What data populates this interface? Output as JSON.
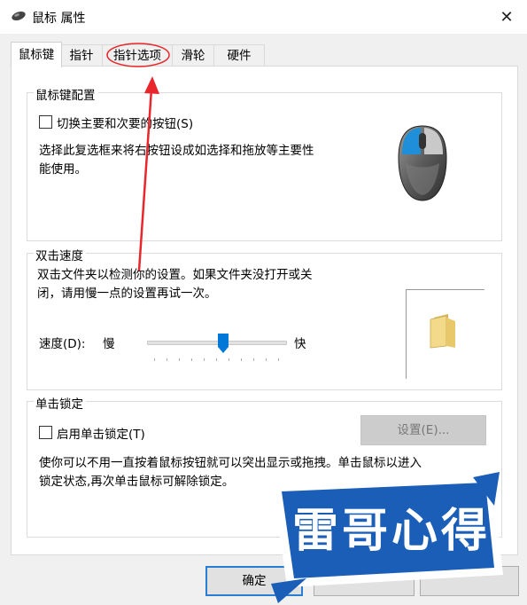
{
  "window": {
    "title": "鼠标 属性",
    "close_glyph": "✕"
  },
  "tabs": [
    {
      "label": "鼠标键",
      "active": true
    },
    {
      "label": "指针",
      "active": false
    },
    {
      "label": "指针选项",
      "active": false
    },
    {
      "label": "滑轮",
      "active": false
    },
    {
      "label": "硬件",
      "active": false
    }
  ],
  "button_config": {
    "title": "鼠标键配置",
    "checkbox_label": "切换主要和次要的按钮(S)",
    "checked": false,
    "description_line1": "选择此复选框来将右按钮设成如选择和拖放等主要性",
    "description_line2": "能使用。"
  },
  "double_click": {
    "title": "双击速度",
    "description_line1": "双击文件夹以检测你的设置。如果文件夹没打开或关",
    "description_line2": "闭，请用慢一点的设置再试一次。",
    "speed_label": "速度(D):",
    "slow_label": "慢",
    "fast_label": "快",
    "speed_value_fraction": 0.55
  },
  "click_lock": {
    "title": "单击锁定",
    "checkbox_label": "启用单击锁定(T)",
    "checked": false,
    "settings_button": "设置(E)...",
    "description_line1": "使你可以不用一直按着鼠标按钮就可以突出显示或拖拽。单击鼠标以进入",
    "description_line2": "锁定状态,再次单击鼠标可解除锁定。"
  },
  "footer": {
    "ok_label": "确定",
    "cancel_label": "",
    "apply_label": ""
  },
  "watermark": {
    "text": "雷哥心得"
  },
  "colors": {
    "annotation_red": "#e8262b",
    "mouse_blue": "#1e8fd8",
    "watermark_blue": "#1a5eb8",
    "focus_blue": "#2b7cd3"
  }
}
